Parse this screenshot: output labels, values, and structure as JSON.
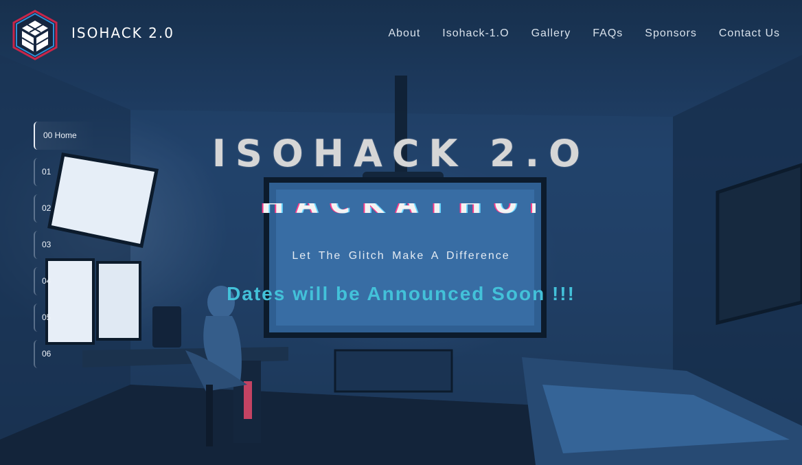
{
  "header": {
    "brand": "ISOHACK 2.0",
    "logo_icon": "isometric-cube-logo-icon",
    "nav": [
      "About",
      "Isohack-1.O",
      "Gallery",
      "FAQs",
      "Sponsors",
      "Contact Us"
    ]
  },
  "side_nav": {
    "items": [
      "00 Home",
      "01",
      "02",
      "03",
      "04",
      "05",
      "06"
    ],
    "active_index": 0
  },
  "hero": {
    "title": "ISOHACK 2.O",
    "glitch_text": "HACKATHON",
    "tagline": "Let The Glitch Make A Difference",
    "dates": "Dates will be Announced Soon !!!"
  },
  "colors": {
    "accent": "#43c1d9",
    "glitch_pink": "#ff3d8b",
    "glitch_cyan": "#6ad7ff",
    "background": "#1d3350"
  }
}
